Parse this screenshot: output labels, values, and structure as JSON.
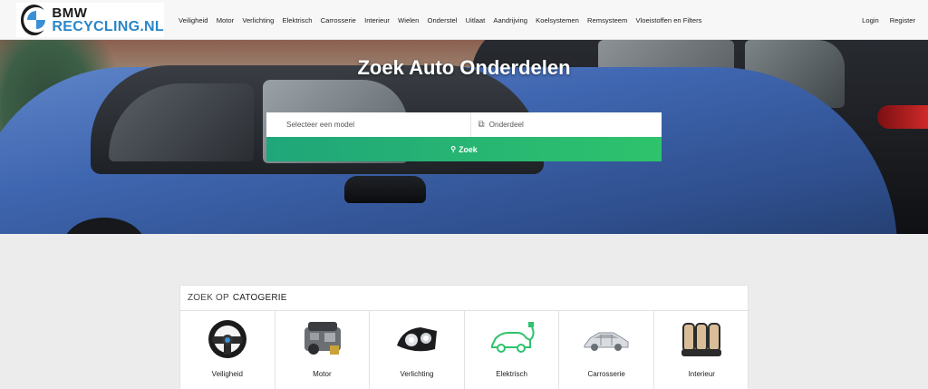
{
  "logo": {
    "line1": "BMW",
    "line2": "RECYCLING.NL"
  },
  "nav": {
    "items": [
      "Veiligheid",
      "Motor",
      "Verlichting",
      "Elektrisch",
      "Carrosserie",
      "Interieur",
      "Wielen",
      "Onderstel",
      "Uitlaat",
      "Aandrijving",
      "Koelsystemen",
      "Remsysteem",
      "Vloeistoffen en Filters"
    ]
  },
  "auth": {
    "login": "Login",
    "register": "Register"
  },
  "hero": {
    "title": "Zoek Auto Onderdelen",
    "model_placeholder": "Selecteer een model",
    "part_placeholder": "Onderdeel",
    "search_label": "Zoek"
  },
  "categories": {
    "heading_prefix": "ZOEK OP",
    "heading_strong": "CATOGERIE",
    "items": [
      {
        "label": "Veiligheid",
        "icon": "steering-wheel-icon"
      },
      {
        "label": "Motor",
        "icon": "engine-icon"
      },
      {
        "label": "Verlichting",
        "icon": "headlight-icon"
      },
      {
        "label": "Elektrisch",
        "icon": "electric-car-icon"
      },
      {
        "label": "Carrosserie",
        "icon": "car-body-icon"
      },
      {
        "label": "Interieur",
        "icon": "car-seats-icon"
      }
    ]
  },
  "colors": {
    "search_button": "#2ec36c",
    "logo_accent": "#2b86c8"
  }
}
